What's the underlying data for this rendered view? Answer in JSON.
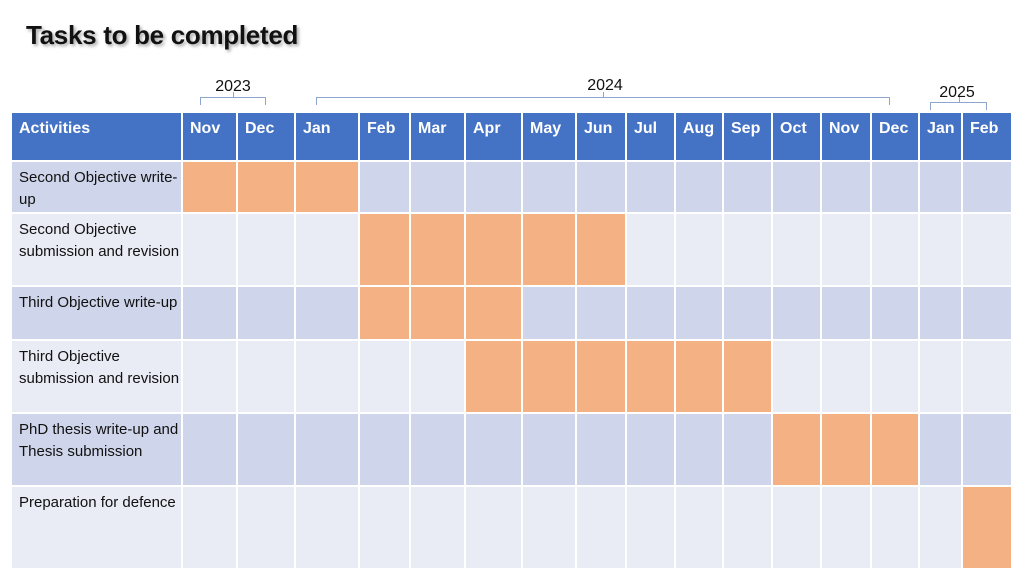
{
  "title": "Tasks to be completed",
  "chart_data": {
    "type": "table",
    "title": "Tasks to be completed",
    "year_groups": [
      {
        "label": "2023",
        "months": [
          "Nov",
          "Dec"
        ]
      },
      {
        "label": "2024",
        "months": [
          "Jan",
          "Feb",
          "Mar",
          "Apr",
          "May",
          "Jun",
          "Jul",
          "Aug",
          "Sep",
          "Oct",
          "Nov",
          "Dec"
        ]
      },
      {
        "label": "2025",
        "months": [
          "Jan",
          "Feb"
        ]
      }
    ],
    "header_label": "Activities",
    "months": [
      "Nov",
      "Dec",
      "Jan",
      "Feb",
      "Mar",
      "Apr",
      "May",
      "Jun",
      "Jul",
      "Aug",
      "Sep",
      "Oct",
      "Nov",
      "Dec",
      "Jan",
      "Feb"
    ],
    "tasks": [
      {
        "name": "Second Objective write-up",
        "start": "Nov 2023",
        "end": "Jan 2024",
        "active": [
          0,
          1,
          2
        ]
      },
      {
        "name": "Second Objective submission and revision",
        "start": "Feb 2024",
        "end": "Jun 2024",
        "active": [
          3,
          4,
          5,
          6,
          7
        ]
      },
      {
        "name": "Third Objective write-up",
        "start": "Feb 2024",
        "end": "Apr 2024",
        "active": [
          3,
          4,
          5
        ]
      },
      {
        "name": "Third Objective submission and revision",
        "start": "Apr 2024",
        "end": "Sep 2024",
        "active": [
          5,
          6,
          7,
          8,
          9,
          10
        ]
      },
      {
        "name": "PhD thesis write-up and Thesis submission",
        "start": "Oct 2024",
        "end": "Dec 2024",
        "active": [
          11,
          12,
          13
        ]
      },
      {
        "name": "Preparation for defence",
        "start": "Feb 2025",
        "end": "Feb 2025",
        "active": [
          15
        ]
      }
    ],
    "colors": {
      "header": "#4472c4",
      "row_odd": "#cfd5ea",
      "row_even": "#e9ebf5",
      "active": "#f4b183"
    }
  }
}
